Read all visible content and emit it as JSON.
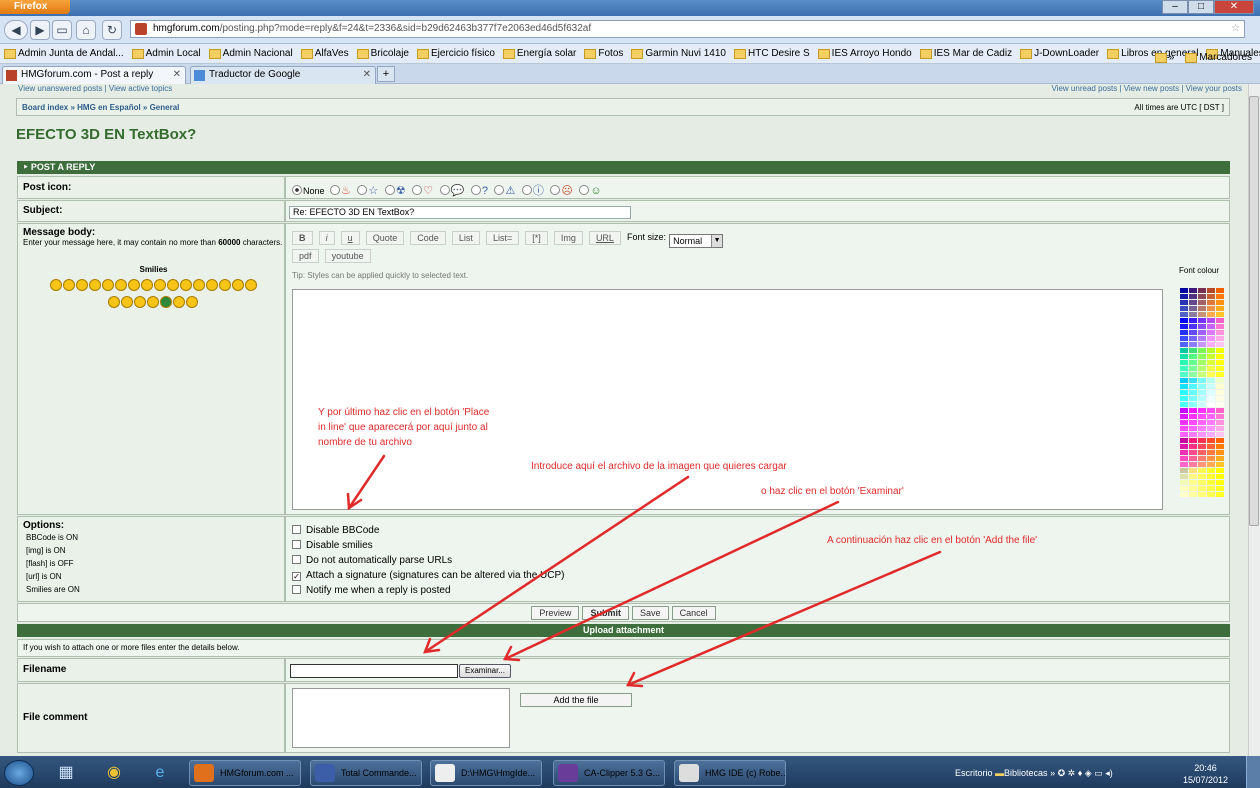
{
  "window": {
    "app_button": "Firefox",
    "controls": [
      "–",
      "□",
      "✕"
    ]
  },
  "nav": {
    "url_domain": "hmgforum.com",
    "url_path": "/posting.php?mode=reply&f=24&t=2336&sid=b29d62463b377f7e2063ed46d5f632af"
  },
  "bookmarks": {
    "items": [
      "Admin Junta de Andal...",
      "Admin Local",
      "Admin Nacional",
      "AlfaVes",
      "Bricolaje",
      "Ejercicio físico",
      "Energía solar",
      "Fotos",
      "Garmin Nuvi 1410",
      "HTC Desire S",
      "IES Arroyo Hondo",
      "IES Mar de Cadiz",
      "J-DownLoader",
      "Libros en general",
      "Manuales"
    ],
    "more": "»",
    "folder": "Marcadores"
  },
  "tabs": [
    {
      "label": "HMGforum.com - Post a reply"
    },
    {
      "label": "Traductor de Google"
    }
  ],
  "forum": {
    "toplinks_left": "View unanswered posts | View active topics",
    "toplinks_right": "View unread posts | View new posts | View your posts",
    "breadcrumb": "Board index » HMG en Español » General",
    "timezone": "All times are UTC [ DST ]",
    "topic_title": "EFECTO 3D EN TextBox?",
    "post_header": "POST A REPLY",
    "post_icon_label": "Post icon:",
    "post_icon_none": "None",
    "subject_label": "Subject:",
    "subject_value": "Re: EFECTO 3D  EN TextBox?",
    "message_label": "Message body:",
    "message_help_a": "Enter your message here, it may contain no more than",
    "message_help_b": "60000",
    "message_help_c": "characters.",
    "smilies_label": "Smilies",
    "toolbar": [
      "B",
      "i",
      "u",
      "Quote",
      "Code",
      "List",
      "List=",
      "[*]",
      "Img",
      "URL"
    ],
    "font_size_label": "Font size:",
    "font_size_value": "Normal",
    "toolbar2": [
      "pdf",
      "youtube"
    ],
    "tip": "Tip: Styles can be applied quickly to selected text.",
    "font_colour_label": "Font colour",
    "options_label": "Options:",
    "options_status": [
      "BBCode is ON",
      "[img] is ON",
      "[flash] is OFF",
      "[url] is ON",
      "Smilies are ON"
    ],
    "checkboxes": [
      {
        "label": "Disable BBCode",
        "checked": false
      },
      {
        "label": "Disable smilies",
        "checked": false
      },
      {
        "label": "Do not automatically parse URLs",
        "checked": false
      },
      {
        "label": "Attach a signature (signatures can be altered via the UCP)",
        "checked": true
      },
      {
        "label": "Notify me when a reply is posted",
        "checked": false
      }
    ],
    "buttons": {
      "preview": "Preview",
      "submit": "Submit",
      "save": "Save",
      "cancel": "Cancel"
    },
    "upload_header": "Upload attachment",
    "upload_help": "If you wish to attach one or more files enter the details below.",
    "filename_label": "Filename",
    "browse_button": "Examinar...",
    "file_comment_label": "File comment",
    "add_file_button": "Add the file"
  },
  "annotations": {
    "note1": "Y por último haz clic en el botón 'Place in line' que aparecerá por aquí junto al nombre de tu archivo",
    "note2": "Introduce aquí el archivo de la imagen que quieres cargar",
    "note3": "o haz clic en el botón 'Examinar'",
    "note4": "A continuación haz clic en el botón 'Add the file'",
    "color": "#e02a2a"
  },
  "taskbar": {
    "tasks": [
      "HMGforum.com ...",
      "Total Commande...",
      "D:\\HMG\\HmgIde...",
      "CA-Clipper 5.3  G...",
      "HMG IDE (c) Robe..."
    ],
    "tray_desktop": "Escritorio",
    "tray_libraries": "Bibliotecas",
    "tray_more": "»",
    "time": "20:46",
    "date": "15/07/2012"
  }
}
